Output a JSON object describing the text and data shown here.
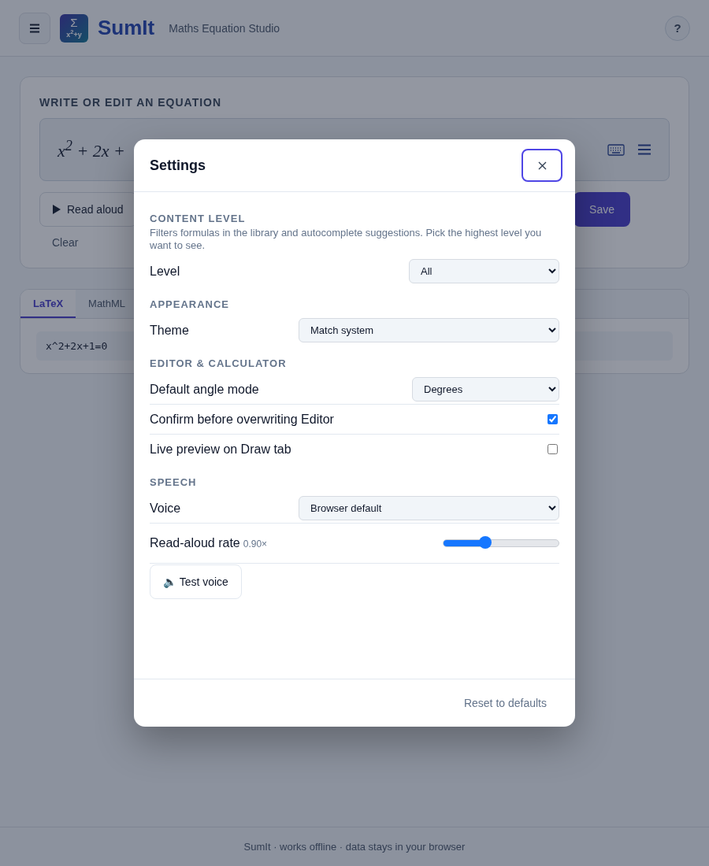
{
  "header": {
    "logo_symbol": "Σ",
    "logo_sub": "x$^{2}$+y",
    "brand": "SumIt",
    "subtitle": "Maths Equation Studio",
    "help": "?"
  },
  "editor": {
    "title": "WRITE OR EDIT AN EQUATION",
    "equation": "x$^{2}$ + 2x +",
    "read_aloud": "Read aloud",
    "clear": "Clear",
    "save": "Save"
  },
  "output": {
    "tabs": [
      {
        "label": "LaTeX",
        "selected": true
      },
      {
        "label": "MathML",
        "selected": false
      }
    ],
    "code": "x^2+2x+1=0"
  },
  "dialog": {
    "title": "Settings",
    "sections": [
      {
        "heading": "CONTENT LEVEL",
        "description": "Filters formulas in the library and autocomplete suggestions. Pick the highest level you want to see.",
        "rows": [
          {
            "kind": "select",
            "label": "Level",
            "value": "All"
          }
        ]
      },
      {
        "heading": "APPEARANCE",
        "rows": [
          {
            "kind": "select",
            "label": "Theme",
            "value": "Match system"
          }
        ]
      },
      {
        "heading": "EDITOR & CALCULATOR",
        "rows": [
          {
            "kind": "select",
            "label": "Default angle mode",
            "value": "Degrees"
          },
          {
            "kind": "checkbox",
            "label": "Confirm before overwriting Editor",
            "checked": true
          },
          {
            "kind": "checkbox",
            "label": "Live preview on Draw tab",
            "checked": false
          }
        ]
      },
      {
        "heading": "SPEECH",
        "rows": [
          {
            "kind": "select",
            "label": "Voice",
            "value": "Browser default"
          },
          {
            "kind": "slider",
            "label": "Read-aloud rate",
            "reading": "0.90×",
            "level": 0.36
          },
          {
            "kind": "button",
            "label": "Test voice",
            "icon": "🔈"
          }
        ]
      }
    ],
    "reset": "Reset to defaults"
  },
  "footer": "SumIt · works offline · data stays in your browser"
}
